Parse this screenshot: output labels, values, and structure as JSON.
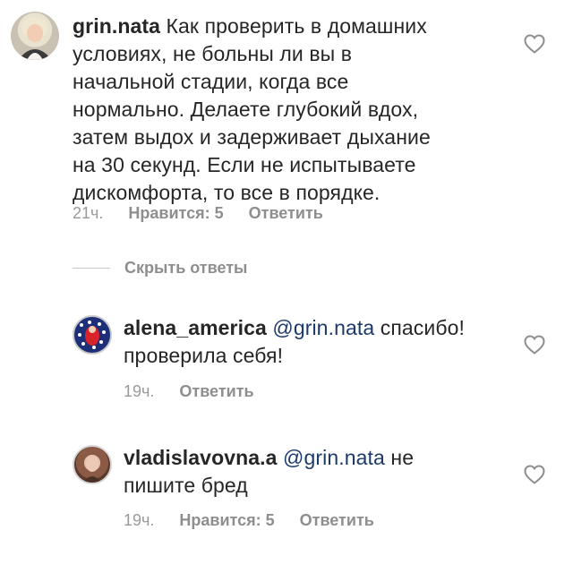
{
  "comments": [
    {
      "username": "grin.nata",
      "lines": [
        "Как проверить в домашних",
        "условиях, не больны ли вы в",
        "начальной стадии, когда все",
        "нормально. Делаете глубокий вдох,",
        "затем выдох и задерживает дыхание",
        "на 30 секунд. Если не испытываете",
        "дискомфорта, то все в порядке."
      ],
      "time": "21ч.",
      "likes": "Нравится: 5",
      "reply": "Ответить"
    }
  ],
  "replies_toggle": "Скрыть ответы",
  "replies": [
    {
      "username": "alena_america",
      "mention": "@grin.nata",
      "line1_rest": "спасибо!",
      "line2": "проверила себя!",
      "time": "19ч.",
      "reply": "Ответить"
    },
    {
      "username": "vladislavovna.a",
      "mention": "@grin.nata",
      "line1_rest": "не",
      "line2": "пишите бред",
      "time": "19ч.",
      "likes": "Нравится: 5",
      "reply": "Ответить"
    }
  ],
  "icons": {
    "like": "heart-outline-icon"
  },
  "colors": {
    "text": "#262626",
    "meta": "#8e8e8e",
    "mention": "#1b3a6b"
  }
}
